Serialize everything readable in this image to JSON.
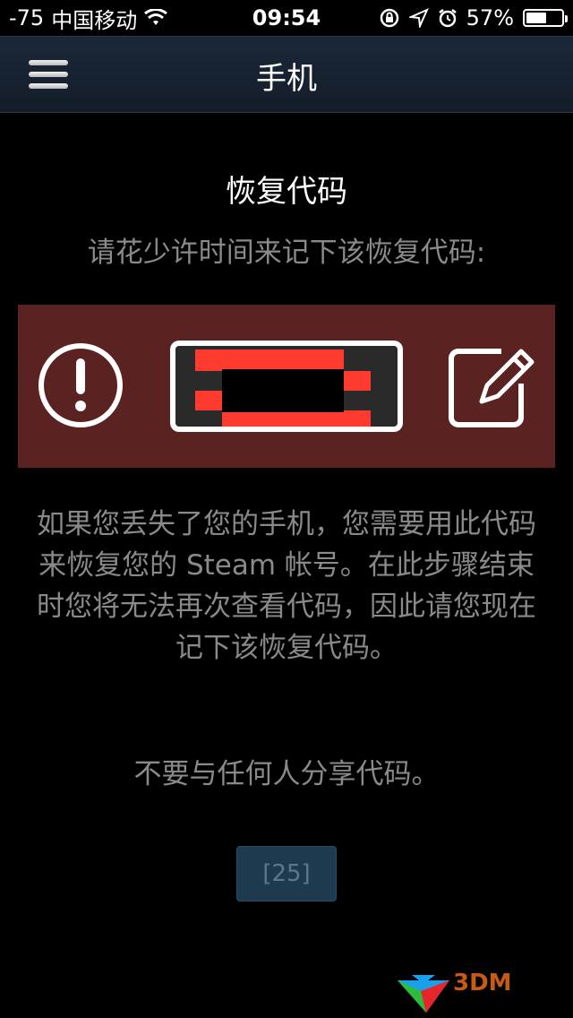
{
  "status_bar": {
    "signal": "-75",
    "carrier": "中国移动",
    "time": "09:54",
    "battery_percent_label": "57%",
    "battery_level": 0.57
  },
  "nav": {
    "title": "手机"
  },
  "content": {
    "heading": "恢复代码",
    "subheading": "请花少许时间来记下该恢复代码:",
    "description": "如果您丢失了您的手机，您需要用此代码来恢复您的 Steam 帐号。在此步骤结束时您将无法再次查看代码，因此请您现在记下该恢复代码。",
    "warning": "不要与任何人分享代码。",
    "countdown_label": "[25]"
  },
  "colors": {
    "nav_bg": "#1b2838",
    "panel_bg": "#5a2321",
    "muted_text": "#8a8a8a",
    "button_bg": "#1e3a4e",
    "redaction_red": "#ff3b30"
  },
  "icons": {
    "alert": "exclamation-circle-icon",
    "edit": "pencil-square-icon",
    "menu": "hamburger-menu-icon",
    "wifi": "wifi-icon",
    "lock": "rotation-lock-icon",
    "location": "location-arrow-icon",
    "alarm": "alarm-clock-icon",
    "battery": "battery-icon"
  },
  "watermark": {
    "text": "3DM"
  }
}
